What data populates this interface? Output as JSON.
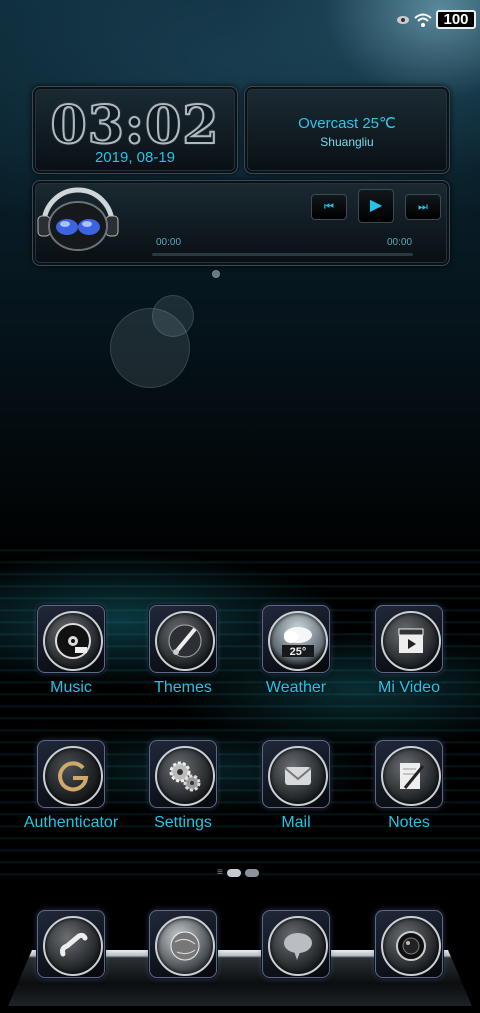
{
  "status_bar": {
    "battery": "100",
    "icons": [
      "eye-icon",
      "wifi-icon"
    ]
  },
  "clock_widget": {
    "time": "03:02",
    "date": "2019, 08-19"
  },
  "weather_widget": {
    "condition": "Overcast 25℃",
    "city": "Shuangliu"
  },
  "music_widget": {
    "elapsed": "00:00",
    "duration": "00:00",
    "progress": 0,
    "controls": [
      "previous-icon",
      "play-icon",
      "next-icon"
    ]
  },
  "apps": [
    {
      "label": "Music",
      "icon": "music-disc-icon"
    },
    {
      "label": "Themes",
      "icon": "themes-brush-icon"
    },
    {
      "label": "Weather",
      "icon": "weather-cloud-icon",
      "badge": "25°"
    },
    {
      "label": "Mi Video",
      "icon": "video-clapper-icon"
    },
    {
      "label": "Authenticator",
      "icon": "authenticator-icon"
    },
    {
      "label": "Settings",
      "icon": "settings-gears-icon"
    },
    {
      "label": "Mail",
      "icon": "mail-envelope-icon"
    },
    {
      "label": "Notes",
      "icon": "notes-pen-icon"
    }
  ],
  "dock": [
    {
      "icon": "phone-icon"
    },
    {
      "icon": "browser-globe-icon"
    },
    {
      "icon": "messages-bubble-icon"
    },
    {
      "icon": "camera-lens-icon"
    }
  ],
  "pager": {
    "pages": 2,
    "current": 1
  },
  "colors": {
    "accent": "#25c3e6",
    "background": "#000000"
  }
}
